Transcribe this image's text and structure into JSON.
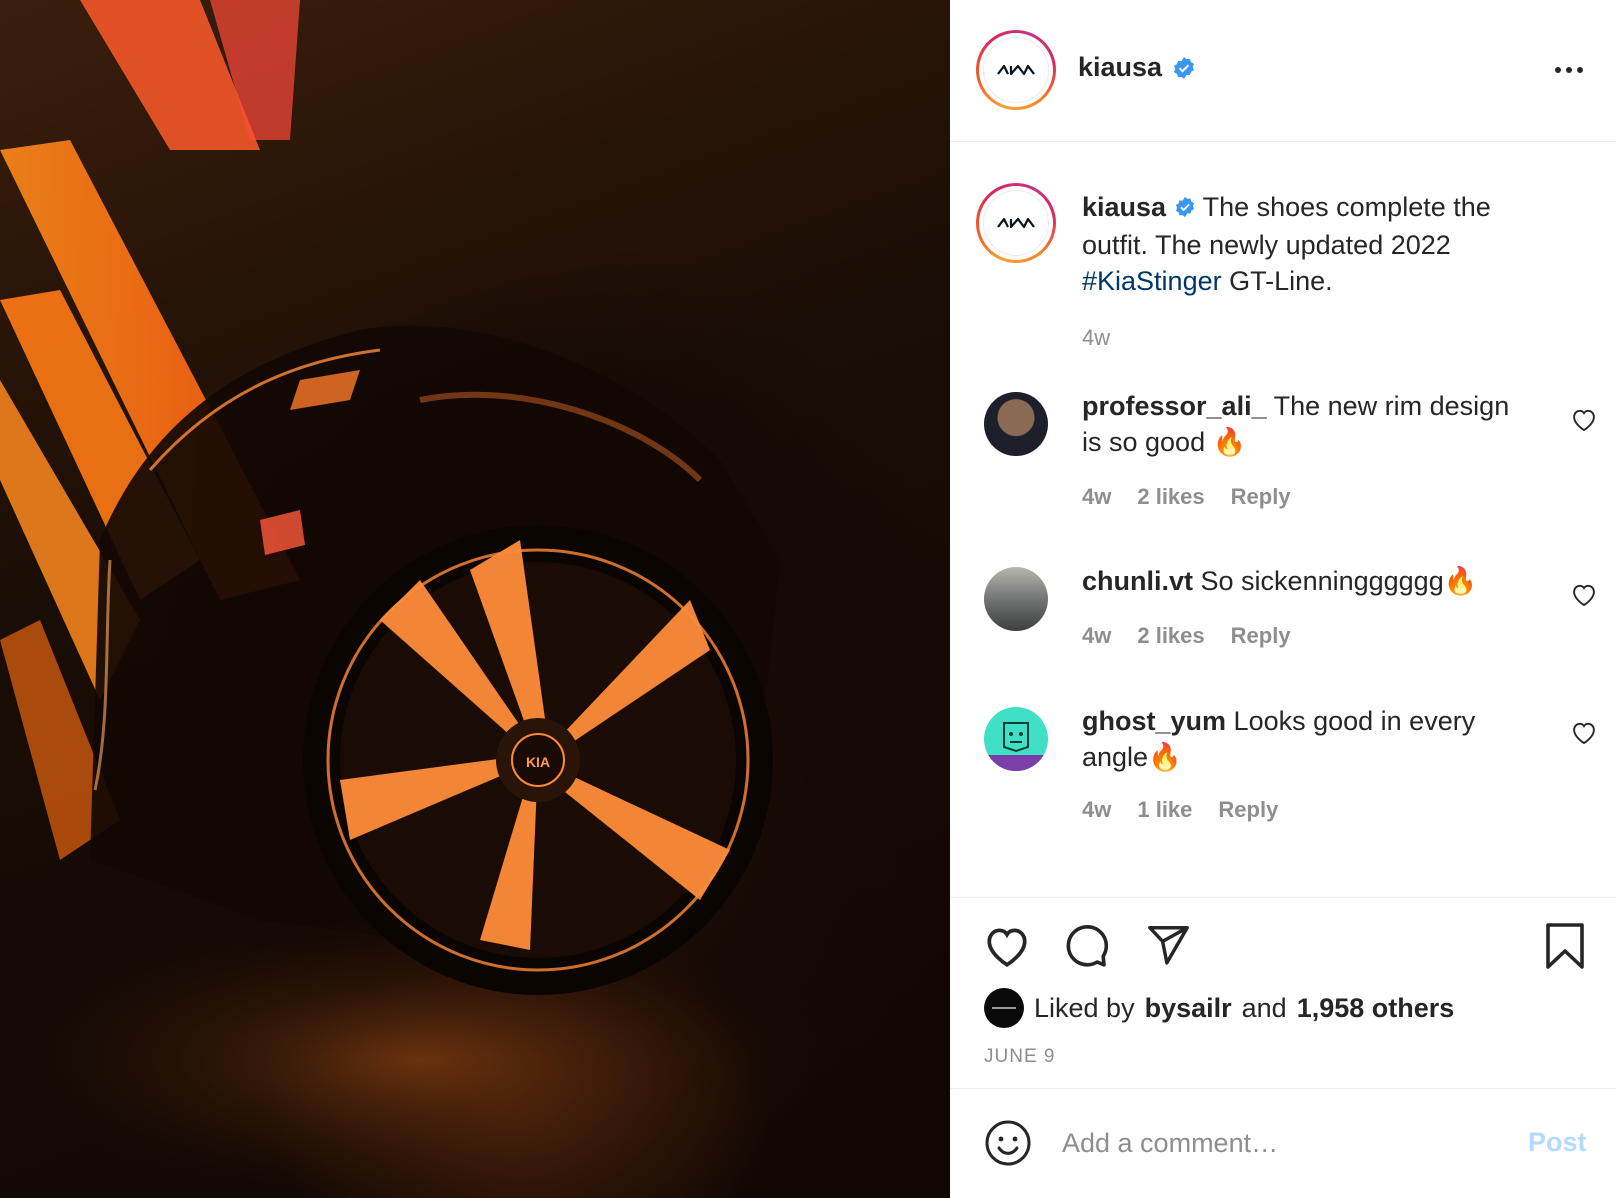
{
  "post": {
    "username": "kiausa",
    "verified": true,
    "avatar_logo": "KIA",
    "caption_text": "The shoes complete the outfit. The newly updated 2022",
    "caption_hashtag": "#KiaStinger",
    "caption_tail": "GT-Line.",
    "caption_time": "4w"
  },
  "comments": [
    {
      "username": "professor_ali_",
      "text": "The new rim design is so good 🔥",
      "time": "4w",
      "likes": "2 likes",
      "reply": "Reply"
    },
    {
      "username": "chunli.vt",
      "text": "So sickenningggggg🔥",
      "time": "4w",
      "likes": "2 likes",
      "reply": "Reply"
    },
    {
      "username": "ghost_yum",
      "text": "Looks good in every angle🔥",
      "time": "4w",
      "likes": "1 like",
      "reply": "Reply"
    }
  ],
  "likes": {
    "prefix": "Liked by",
    "liker": "bysailr",
    "conjunction": "and",
    "others": "1,958 others"
  },
  "date": "JUNE 9",
  "add_comment": {
    "placeholder": "Add a comment…",
    "post_label": "Post"
  },
  "icons": {
    "more": "more-options-icon",
    "like": "heart-icon",
    "comment": "comment-bubble-icon",
    "share": "paper-plane-icon",
    "save": "bookmark-icon",
    "emoji": "smiley-icon",
    "verified": "verified-badge-icon"
  },
  "colors": {
    "text": "#262626",
    "muted": "#8e8e8e",
    "hashtag": "#00376b",
    "verified": "#3897f0",
    "post_disabled": "#b3dbff"
  }
}
